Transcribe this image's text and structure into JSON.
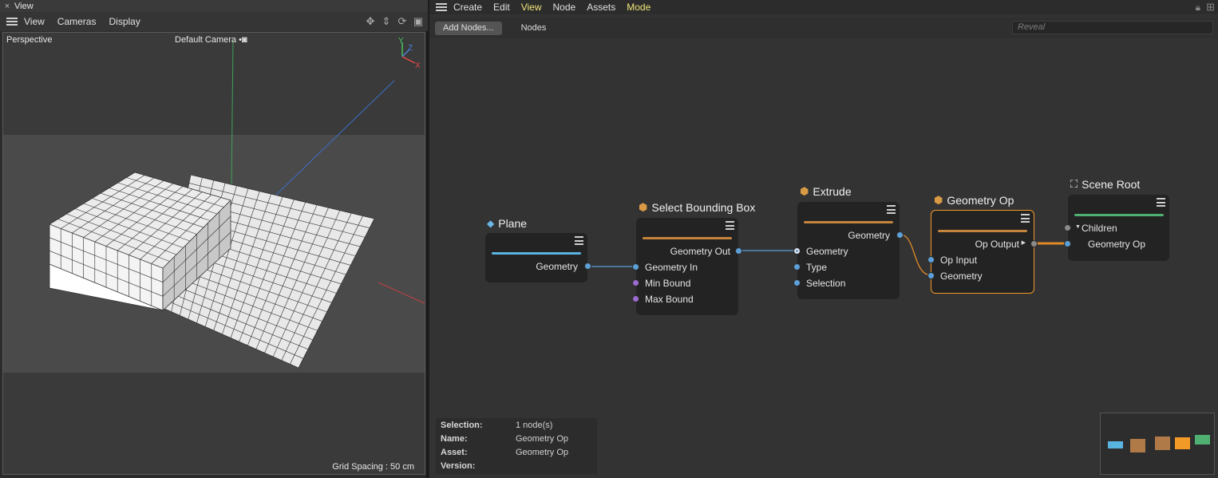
{
  "left_panel": {
    "title": "View",
    "close_glyph": "×",
    "menu": [
      "View",
      "Cameras",
      "Display"
    ],
    "viewport": {
      "projection": "Perspective",
      "camera": "Default Camera",
      "camera_icon": "•◙",
      "grid_spacing": "Grid Spacing : 50 cm",
      "axis_labels": {
        "x": "X",
        "y": "Y",
        "z": "Z"
      }
    },
    "tools": [
      "move-view-icon",
      "dolly-icon",
      "rotate-view-icon",
      "layout-icon"
    ],
    "tool_glyphs": [
      "✥",
      "⇕",
      "⟳",
      "▣"
    ]
  },
  "right_panel": {
    "menu": [
      "Create",
      "Edit",
      "View",
      "Node",
      "Assets",
      "Mode"
    ],
    "active_menu": [
      "View",
      "Mode"
    ],
    "toolbar": {
      "add_nodes": "Add Nodes...",
      "nodes_tab": "Nodes",
      "search_placeholder": "Reveal"
    },
    "nodes": [
      {
        "id": "plane",
        "title": "Plane",
        "color": "#5ab4e0",
        "outputs": [
          "Geometry"
        ],
        "inputs": []
      },
      {
        "id": "select_bbox",
        "title": "Select Bounding Box",
        "color": "#c4843c",
        "outputs": [
          "Geometry Out"
        ],
        "inputs": [
          "Geometry In",
          "Min Bound",
          "Max Bound"
        ]
      },
      {
        "id": "extrude",
        "title": "Extrude",
        "color": "#c4843c",
        "outputs": [
          "Geometry"
        ],
        "inputs": [
          "Geometry",
          "Type",
          "Selection"
        ]
      },
      {
        "id": "geometry_op",
        "title": "Geometry Op",
        "color": "#c4843c",
        "outputs": [
          "Op Output"
        ],
        "inputs": [
          "Op Input",
          "Geometry"
        ],
        "selected": true
      },
      {
        "id": "scene_root",
        "title": "Scene Root",
        "color": "#4fb072",
        "outputs": [],
        "inputs": [
          "Children",
          "Geometry Op"
        ]
      }
    ],
    "info": {
      "selection_label": "Selection:",
      "selection_value": "1 node(s)",
      "name_label": "Name:",
      "name_value": "Geometry Op",
      "asset_label": "Asset:",
      "asset_value": "Geometry Op",
      "version_label": "Version:",
      "version_value": ""
    },
    "minimap_colors": [
      "#5ab4e0",
      "#b07a48",
      "#b07a48",
      "#f29a28",
      "#4fb072"
    ]
  }
}
